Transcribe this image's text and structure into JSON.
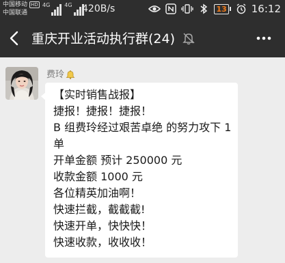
{
  "status_bar": {
    "carrier1": "中国移动",
    "carrier1_badge": "HD",
    "carrier2": "中国联通",
    "signal1_label": "4G",
    "signal2_label": "4G",
    "net_speed": "420B/s",
    "battery_level": "13",
    "time": "16:12",
    "icons": [
      "eye-icon",
      "nfc-icon",
      "vibrate-icon",
      "bluetooth-icon",
      "alarm-icon"
    ],
    "battery_color": "#f07a1a"
  },
  "nav": {
    "back_icon": "back-arrow-icon",
    "title": "重庆开业活动执行群(24)",
    "mute_icon": "mute-bell-icon",
    "more_icon": "more-dots-icon"
  },
  "message": {
    "sender": "费玲",
    "sender_badge_icon": "bell-icon",
    "lines": [
      "【实时销售战报】",
      "捷报！捷报！捷报！",
      "B 组费玲经过艰苦卓绝 的努力攻下 1",
      "单",
      "开单金额 预计 250000 元",
      "收款金额 1000 元",
      "各位精英加油啊！",
      "快速拦截，截截截!",
      "快速开单，快快快！",
      "快速收款，收收收！"
    ]
  },
  "colors": {
    "header_bg": "#2e2e2e",
    "chat_bg": "#ededed",
    "bubble_bg": "#ffffff"
  }
}
